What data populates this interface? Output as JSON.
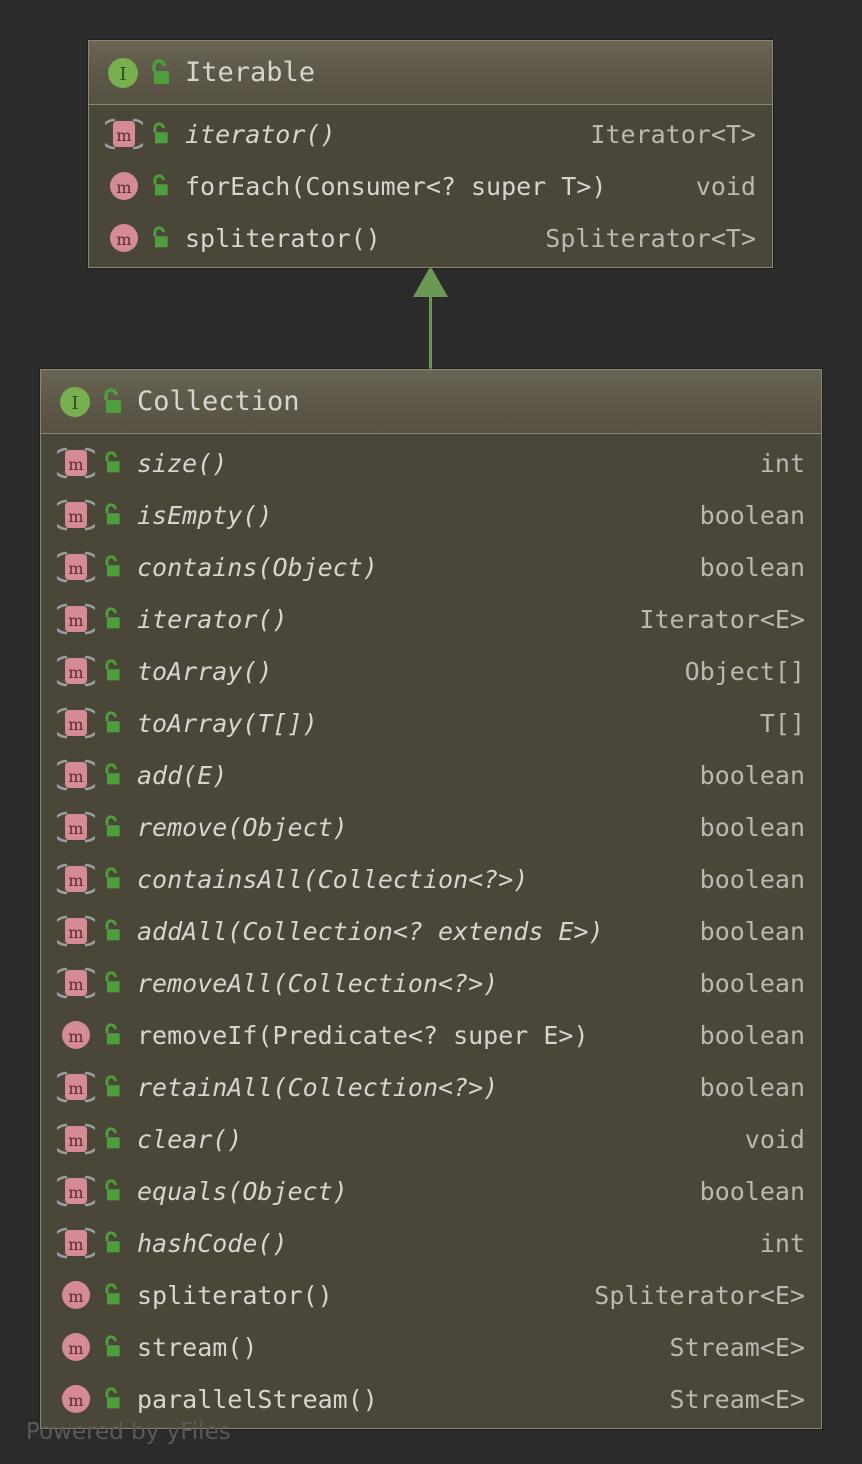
{
  "background_color": "#2b2b2b",
  "palette": {
    "class_body": "#4a4738",
    "class_header": "#5d5747",
    "class_border": "#8b8574",
    "member_text": "#d6d6d0",
    "type_text": "#b9b9b1",
    "interface_icon": "#78b050",
    "method_icon": "#d58b94",
    "lock_icon": "#4f9e3e",
    "edge_green": "#6a9955",
    "watermark_text": "#5a5a5a"
  },
  "diagram": {
    "kind": "uml-class-diagram",
    "relation": {
      "name": "generalization",
      "label": "",
      "from": "Collection",
      "to": "Iterable",
      "arrow": "filled-triangle-up"
    }
  },
  "classes": [
    {
      "name": "Iterable",
      "stereotype": "interface",
      "type_icon": "interface-icon",
      "visibility_icon": "unlocked-padlock-icon",
      "members": [
        {
          "icon": "abstract-method-icon",
          "abstract": true,
          "visibility_icon": "unlocked-padlock-icon",
          "signature": "iterator()",
          "return_type": "Iterator<T>"
        },
        {
          "icon": "method-icon",
          "abstract": false,
          "visibility_icon": "unlocked-padlock-icon",
          "signature": "forEach(Consumer<? super T>)",
          "return_type": "void"
        },
        {
          "icon": "method-icon",
          "abstract": false,
          "visibility_icon": "unlocked-padlock-icon",
          "signature": "spliterator()",
          "return_type": "Spliterator<T>"
        }
      ]
    },
    {
      "name": "Collection",
      "stereotype": "interface",
      "type_icon": "interface-icon",
      "visibility_icon": "unlocked-padlock-icon",
      "members": [
        {
          "icon": "abstract-method-icon",
          "abstract": true,
          "visibility_icon": "unlocked-padlock-icon",
          "signature": "size()",
          "return_type": "int"
        },
        {
          "icon": "abstract-method-icon",
          "abstract": true,
          "visibility_icon": "unlocked-padlock-icon",
          "signature": "isEmpty()",
          "return_type": "boolean"
        },
        {
          "icon": "abstract-method-icon",
          "abstract": true,
          "visibility_icon": "unlocked-padlock-icon",
          "signature": "contains(Object)",
          "return_type": "boolean"
        },
        {
          "icon": "abstract-method-icon",
          "abstract": true,
          "visibility_icon": "unlocked-padlock-icon",
          "signature": "iterator()",
          "return_type": "Iterator<E>"
        },
        {
          "icon": "abstract-method-icon",
          "abstract": true,
          "visibility_icon": "unlocked-padlock-icon",
          "signature": "toArray()",
          "return_type": "Object[]"
        },
        {
          "icon": "abstract-method-icon",
          "abstract": true,
          "visibility_icon": "unlocked-padlock-icon",
          "signature": "toArray(T[])",
          "return_type": "T[]"
        },
        {
          "icon": "abstract-method-icon",
          "abstract": true,
          "visibility_icon": "unlocked-padlock-icon",
          "signature": "add(E)",
          "return_type": "boolean"
        },
        {
          "icon": "abstract-method-icon",
          "abstract": true,
          "visibility_icon": "unlocked-padlock-icon",
          "signature": "remove(Object)",
          "return_type": "boolean"
        },
        {
          "icon": "abstract-method-icon",
          "abstract": true,
          "visibility_icon": "unlocked-padlock-icon",
          "signature": "containsAll(Collection<?>)",
          "return_type": "boolean"
        },
        {
          "icon": "abstract-method-icon",
          "abstract": true,
          "visibility_icon": "unlocked-padlock-icon",
          "signature": "addAll(Collection<? extends E>)",
          "return_type": "boolean"
        },
        {
          "icon": "abstract-method-icon",
          "abstract": true,
          "visibility_icon": "unlocked-padlock-icon",
          "signature": "removeAll(Collection<?>)",
          "return_type": "boolean"
        },
        {
          "icon": "method-icon",
          "abstract": false,
          "visibility_icon": "unlocked-padlock-icon",
          "signature": "removeIf(Predicate<? super E>)",
          "return_type": "boolean"
        },
        {
          "icon": "abstract-method-icon",
          "abstract": true,
          "visibility_icon": "unlocked-padlock-icon",
          "signature": "retainAll(Collection<?>)",
          "return_type": "boolean"
        },
        {
          "icon": "abstract-method-icon",
          "abstract": true,
          "visibility_icon": "unlocked-padlock-icon",
          "signature": "clear()",
          "return_type": "void"
        },
        {
          "icon": "abstract-method-icon",
          "abstract": true,
          "visibility_icon": "unlocked-padlock-icon",
          "signature": "equals(Object)",
          "return_type": "boolean"
        },
        {
          "icon": "abstract-method-icon",
          "abstract": true,
          "visibility_icon": "unlocked-padlock-icon",
          "signature": "hashCode()",
          "return_type": "int"
        },
        {
          "icon": "method-icon",
          "abstract": false,
          "visibility_icon": "unlocked-padlock-icon",
          "signature": "spliterator()",
          "return_type": "Spliterator<E>"
        },
        {
          "icon": "method-icon",
          "abstract": false,
          "visibility_icon": "unlocked-padlock-icon",
          "signature": "stream()",
          "return_type": "Stream<E>"
        },
        {
          "icon": "method-icon",
          "abstract": false,
          "visibility_icon": "unlocked-padlock-icon",
          "signature": "parallelStream()",
          "return_type": "Stream<E>"
        }
      ]
    }
  ],
  "watermark": {
    "text": "Powered by yFiles"
  }
}
